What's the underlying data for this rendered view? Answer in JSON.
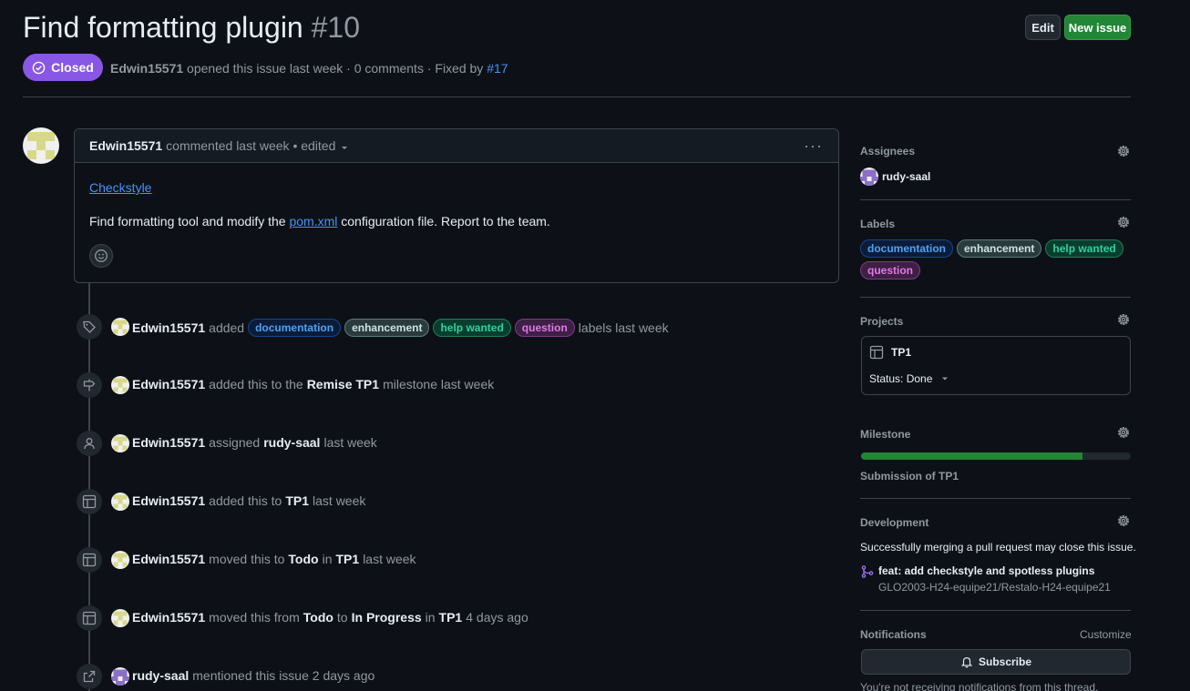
{
  "issue": {
    "title": "Find formatting plugin",
    "number": "#10",
    "state": "Closed",
    "author": "Edwin15571",
    "opened_text": "opened this issue last week · 0 comments · Fixed by",
    "fixed_by": "#17"
  },
  "header_buttons": {
    "edit": "Edit",
    "new_issue": "New issue"
  },
  "comment": {
    "author": "Edwin15571",
    "meta": "commented last week • edited",
    "link": "Checkstyle",
    "body_before": "Find formatting tool and modify the",
    "body_link": "pom.xml",
    "body_after": "configuration file. Report to the team.",
    "menu": "···"
  },
  "timeline": [
    {
      "icon": "tag-icon",
      "actor": "Edwin15571",
      "pre": "added",
      "labels": [
        "documentation",
        "enhancement",
        "help wanted",
        "question"
      ],
      "post": "labels last week"
    },
    {
      "icon": "milestone-icon",
      "actor": "Edwin15571",
      "pre": "added this to the",
      "target": "Remise TP1",
      "post": "milestone last week"
    },
    {
      "icon": "person-icon",
      "actor": "Edwin15571",
      "pre": "assigned",
      "target": "rudy-saal",
      "post": "last week"
    },
    {
      "icon": "project-icon",
      "actor": "Edwin15571",
      "pre": "added this to",
      "target": "TP1",
      "post": "last week"
    },
    {
      "icon": "project-icon",
      "actor": "Edwin15571",
      "pre": "moved this to",
      "target": "Todo",
      "mid": "in",
      "target2": "TP1",
      "post": "last week"
    },
    {
      "icon": "project-icon",
      "actor": "Edwin15571",
      "pre": "moved this from",
      "target": "Todo",
      "mid": "to",
      "target2": "In Progress",
      "mid2": "in",
      "target3": "TP1",
      "post": "4 days ago"
    },
    {
      "icon": "cross-reference-icon",
      "actor": "rudy-saal",
      "pre": "mentioned this issue 2 days ago"
    }
  ],
  "sidebar": {
    "assignees": {
      "title": "Assignees",
      "user": "rudy-saal"
    },
    "labels": {
      "title": "Labels",
      "items": [
        "documentation",
        "enhancement",
        "help wanted",
        "question"
      ]
    },
    "projects": {
      "title": "Projects",
      "name": "TP1",
      "status": "Status: Done"
    },
    "milestone": {
      "title": "Milestone",
      "name": "Submission of TP1",
      "progress": 0.82
    },
    "development": {
      "title": "Development",
      "text": "Successfully merging a pull request may close this issue.",
      "pr_title": "feat: add checkstyle and spotless plugins",
      "pr_repo": "GLO2003-H24-equipe21/Restalo-H24-equipe21"
    },
    "notifications": {
      "title": "Notifications",
      "customize": "Customize",
      "subscribe": "Subscribe",
      "status": "You're not receiving notifications from this thread."
    }
  },
  "colors": {
    "closed": "#8957e5",
    "primary": "#238636",
    "link": "#4493f8",
    "background": "#0d1117"
  }
}
